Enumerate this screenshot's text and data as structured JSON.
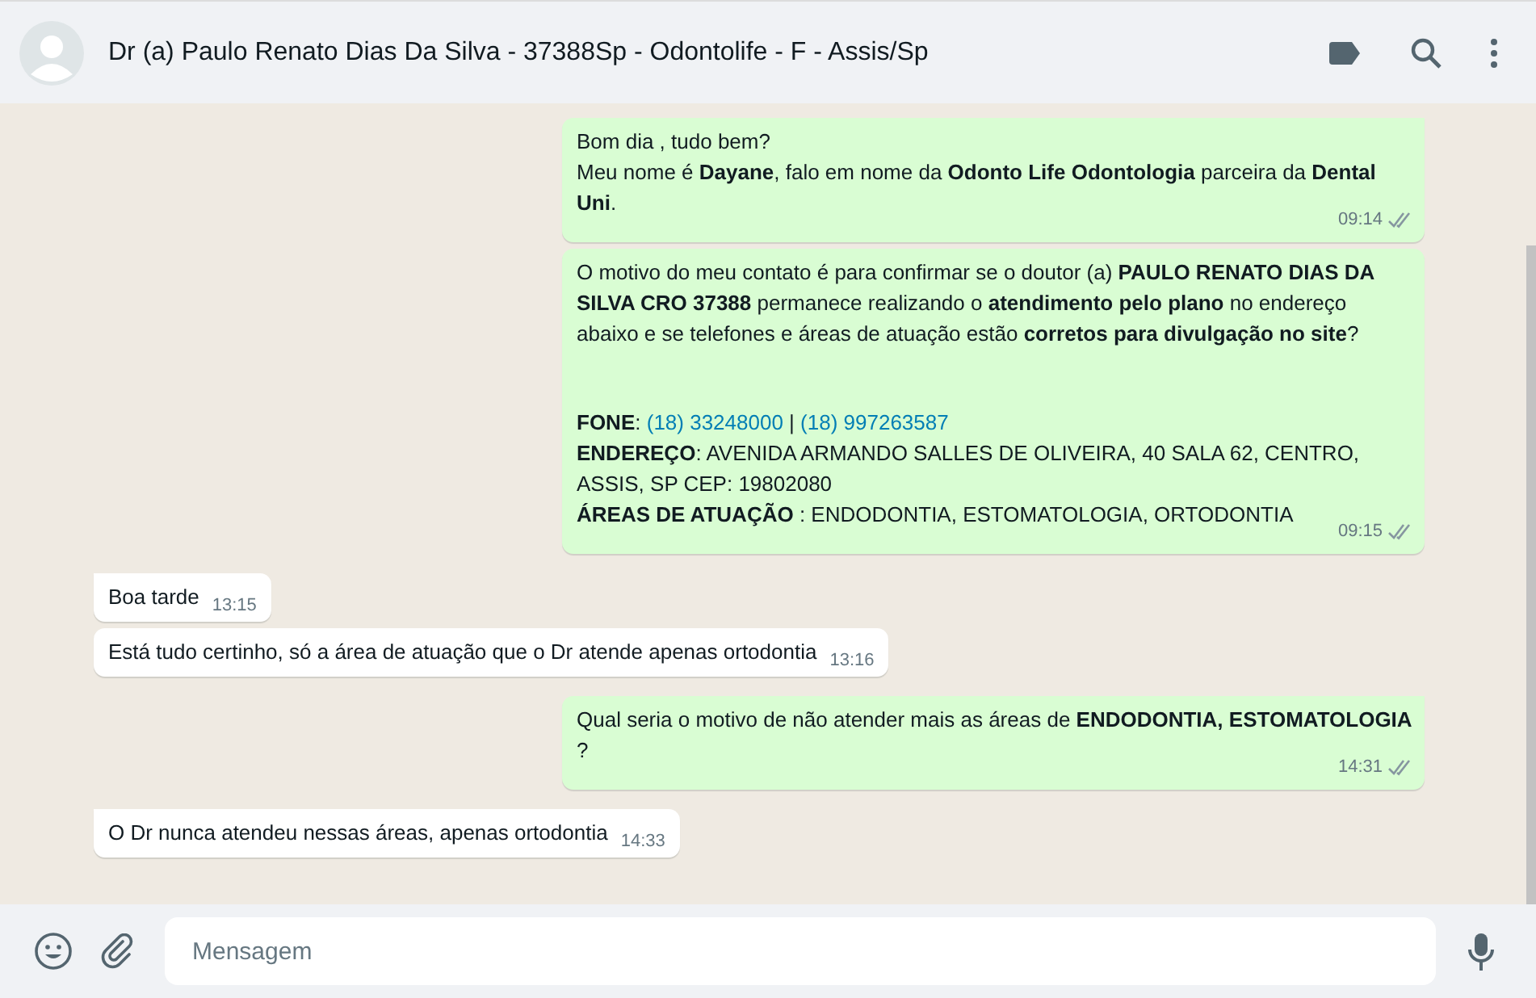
{
  "header": {
    "title": "Dr (a) Paulo Renato Dias Da Silva - 37388Sp - Odontolife - F - Assis/Sp"
  },
  "messages": [
    {
      "outgoing": true,
      "time": "09:14",
      "read": false,
      "blocks": [
        [
          [
            {
              "kind": "text",
              "text": "Bom dia , tudo bem?"
            }
          ],
          [
            {
              "kind": "text",
              "text": "Meu nome é **Dayane**, falo em nome da **Odonto Life Odontologia** parceira da **Dental Uni**."
            }
          ]
        ]
      ]
    },
    {
      "outgoing": true,
      "time": "09:15",
      "read": false,
      "blocks": [
        [
          [
            {
              "kind": "text",
              "text": "O motivo do meu contato é para confirmar se o doutor (a) **PAULO RENATO DIAS DA SILVA CRO 37388** permanece realizando o **atendimento pelo plano** no endereço abaixo e se telefones e áreas de atuação estão **corretos para divulgação no site**?"
            }
          ]
        ],
        [
          [
            {
              "kind": "text",
              "text": "**FONE**: "
            },
            {
              "kind": "link",
              "text": "(18) 33248000"
            },
            {
              "kind": "text",
              "text": " | "
            },
            {
              "kind": "link",
              "text": "(18) 997263587"
            }
          ],
          [
            {
              "kind": "text",
              "text": "**ENDEREÇO**: AVENIDA ARMANDO SALLES DE OLIVEIRA, 40 SALA 62, CENTRO, ASSIS, SP CEP: 19802080"
            }
          ],
          [
            {
              "kind": "text",
              "text": "**ÁREAS DE ATUAÇÃO** : ENDODONTIA, ESTOMATOLOGIA, ORTODONTIA"
            }
          ]
        ]
      ]
    },
    {
      "outgoing": false,
      "time": "13:15",
      "blocks": [
        [
          [
            {
              "kind": "text",
              "text": "Boa tarde"
            }
          ]
        ]
      ]
    },
    {
      "outgoing": false,
      "time": "13:16",
      "blocks": [
        [
          [
            {
              "kind": "text",
              "text": "Está tudo certinho, só a área de atuação que o Dr atende apenas ortodontia"
            }
          ]
        ]
      ]
    },
    {
      "outgoing": true,
      "time": "14:31",
      "read": false,
      "blocks": [
        [
          [
            {
              "kind": "text",
              "text": "Qual seria o motivo de não atender mais as áreas de **ENDODONTIA, ESTOMATOLOGIA** ?"
            }
          ]
        ]
      ]
    },
    {
      "outgoing": false,
      "time": "14:33",
      "blocks": [
        [
          [
            {
              "kind": "text",
              "text": "O Dr nunca atendeu nessas áreas, apenas ortodontia"
            }
          ]
        ]
      ]
    }
  ],
  "composer": {
    "placeholder": "Mensagem"
  }
}
